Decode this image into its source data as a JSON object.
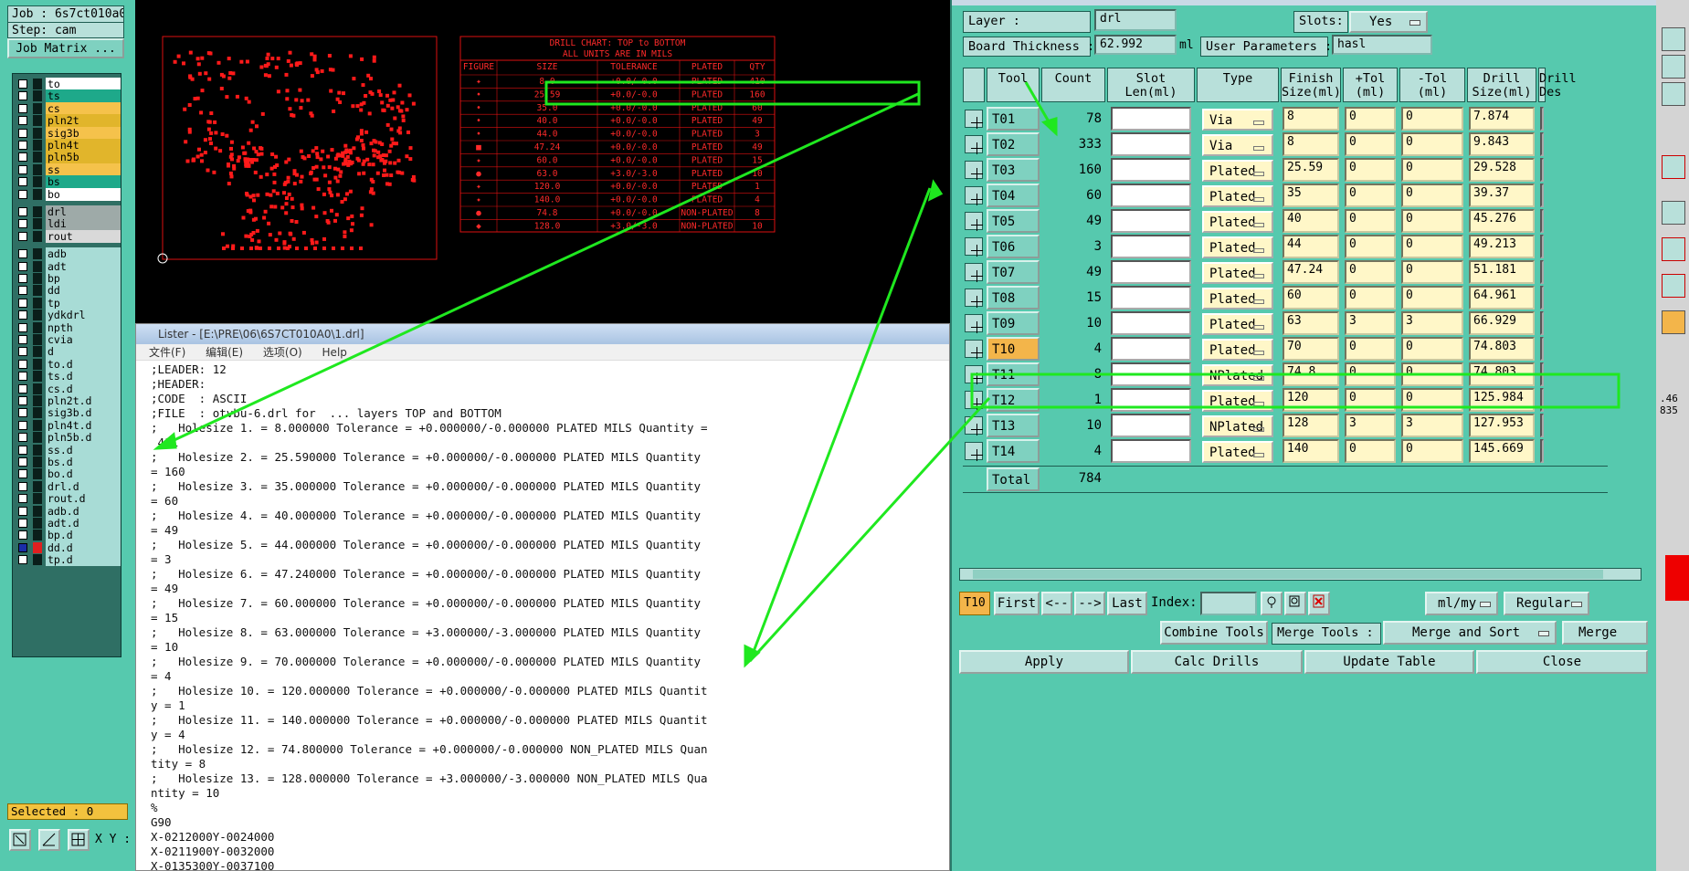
{
  "job": {
    "job_line": "Job : 6s7ct010a0",
    "step_line": "Step: cam",
    "job_matrix_label": "Job Matrix ...",
    "selected": "Selected : 0",
    "xy_label": "X Y :",
    "right_edge": ".46\n835"
  },
  "colors": {
    "panel": "#56c9ae",
    "accent_green": "#1fe81f",
    "selected_tool": "#f3b54a",
    "pcb_red": "#ff1a1a"
  },
  "layers": [
    {
      "name": "to",
      "color": "#ffffff",
      "swatch": "#0a1e1a"
    },
    {
      "name": "ts",
      "color": "#1ea98a",
      "swatch": "#0a1e1a"
    },
    {
      "name": "cs",
      "color": "#f5c24b",
      "swatch": "#0a1e1a"
    },
    {
      "name": "pln2t",
      "color": "#e1b52b",
      "swatch": "#0a1e1a"
    },
    {
      "name": "sig3b",
      "color": "#f5c24b",
      "swatch": "#0a1e1a"
    },
    {
      "name": "pln4t",
      "color": "#e1b52b",
      "swatch": "#0a1e1a"
    },
    {
      "name": "pln5b",
      "color": "#e1b52b",
      "swatch": "#0a1e1a"
    },
    {
      "name": "ss",
      "color": "#f5c24b",
      "swatch": "#0a1e1a"
    },
    {
      "name": "bs",
      "color": "#1ea98a",
      "swatch": "#0a1e1a"
    },
    {
      "name": "bo",
      "color": "#ffffff",
      "swatch": "#0a1e1a"
    },
    {
      "name": "drl",
      "color": "#9eaaa8",
      "swatch": "#0a1e1a"
    },
    {
      "name": "ldi",
      "color": "#9eaaa8",
      "swatch": "#0a1e1a"
    },
    {
      "name": "rout",
      "color": "#d9d9d9",
      "swatch": "#0a1e1a"
    },
    {
      "name": "adb",
      "color": "#a8dcd6",
      "swatch": "#0a1e1a"
    },
    {
      "name": "adt",
      "color": "#a8dcd6",
      "swatch": "#0a1e1a"
    },
    {
      "name": "bp",
      "color": "#a8dcd6",
      "swatch": "#0a1e1a"
    },
    {
      "name": "dd",
      "color": "#a8dcd6",
      "swatch": "#0a1e1a"
    },
    {
      "name": "tp",
      "color": "#a8dcd6",
      "swatch": "#0a1e1a"
    },
    {
      "name": "ydkdrl",
      "color": "#a8dcd6",
      "swatch": "#0a1e1a"
    },
    {
      "name": "npth",
      "color": "#a8dcd6",
      "swatch": "#0a1e1a"
    },
    {
      "name": "cvia",
      "color": "#a8dcd6",
      "swatch": "#0a1e1a"
    },
    {
      "name": "d",
      "color": "#a8dcd6",
      "swatch": "#0a1e1a"
    },
    {
      "name": "to.d",
      "color": "#a8dcd6",
      "swatch": "#0a1e1a",
      "mark": "◆"
    },
    {
      "name": "ts.d",
      "color": "#a8dcd6",
      "swatch": "#0a1e1a"
    },
    {
      "name": "cs.d",
      "color": "#a8dcd6",
      "swatch": "#0a1e1a"
    },
    {
      "name": "pln2t.d",
      "color": "#a8dcd6",
      "swatch": "#0a1e1a"
    },
    {
      "name": "sig3b.d",
      "color": "#a8dcd6",
      "swatch": "#0a1e1a"
    },
    {
      "name": "pln4t.d",
      "color": "#a8dcd6",
      "swatch": "#0a1e1a"
    },
    {
      "name": "pln5b.d",
      "color": "#a8dcd6",
      "swatch": "#0a1e1a"
    },
    {
      "name": "ss.d",
      "color": "#a8dcd6",
      "swatch": "#0a1e1a"
    },
    {
      "name": "bs.d",
      "color": "#a8dcd6",
      "swatch": "#0a1e1a"
    },
    {
      "name": "bo.d",
      "color": "#a8dcd6",
      "swatch": "#0a1e1a"
    },
    {
      "name": "drl.d",
      "color": "#a8dcd6",
      "swatch": "#0a1e1a"
    },
    {
      "name": "rout.d",
      "color": "#a8dcd6",
      "swatch": "#0a1e1a"
    },
    {
      "name": "adb.d",
      "color": "#a8dcd6",
      "swatch": "#0a1e1a"
    },
    {
      "name": "adt.d",
      "color": "#a8dcd6",
      "swatch": "#0a1e1a",
      "mark": "◆"
    },
    {
      "name": "bp.d",
      "color": "#a8dcd6",
      "swatch": "#0a1e1a"
    },
    {
      "name": "dd.d",
      "color": "#a8dcd6",
      "swatch": "#e02020",
      "checked": true,
      "mark": "▪"
    },
    {
      "name": "tp.d",
      "color": "#a8dcd6",
      "swatch": "#0a1e1a"
    }
  ],
  "drill_chart": {
    "title": "DRILL CHART: TOP to BOTTOM",
    "subtitle": "ALL UNITS ARE IN MILS",
    "headers": [
      "FIGURE",
      "SIZE",
      "TOLERANCE",
      "PLATED",
      "QTY"
    ],
    "rows": [
      [
        "✦",
        "8.0",
        "+0.0/-0.0",
        "PLATED",
        "410"
      ],
      [
        "•",
        "25.59",
        "+0.0/-0.0",
        "PLATED",
        "160"
      ],
      [
        "•",
        "35.0",
        "+0.0/-0.0",
        "PLATED",
        "60"
      ],
      [
        "•",
        "40.0",
        "+0.0/-0.0",
        "PLATED",
        "49"
      ],
      [
        "•",
        "44.0",
        "+0.0/-0.0",
        "PLATED",
        "3"
      ],
      [
        "■",
        "47.24",
        "+0.0/-0.0",
        "PLATED",
        "49"
      ],
      [
        "✦",
        "60.0",
        "+0.0/-0.0",
        "PLATED",
        "15"
      ],
      [
        "●",
        "63.0",
        "+3.0/-3.0",
        "PLATED",
        "10"
      ],
      [
        "✦",
        "120.0",
        "+0.0/-0.0",
        "PLATED",
        "1"
      ],
      [
        "✦",
        "140.0",
        "+0.0/-0.0",
        "PLATED",
        "4"
      ],
      [
        "●",
        "74.8",
        "+0.0/-0.0",
        "NON-PLATED",
        "8"
      ],
      [
        "◆",
        "128.0",
        "+3.0/-3.0",
        "NON-PLATED",
        "10"
      ]
    ]
  },
  "lister": {
    "title": "Lister - [E:\\PRE\\06\\6S7CT010A0\\1.drl]",
    "menus": [
      "文件(F)",
      "编辑(E)",
      "选项(O)",
      "Help"
    ],
    "lines": [
      ";LEADER: 12",
      ";HEADER:",
      ";CODE  : ASCII",
      ";FILE  : otvbu-6.drl for  ... layers TOP and BOTTOM",
      ";   Holesize 1. = 8.000000 Tolerance = +0.000000/-0.000000 PLATED MILS Quantity =",
      " 411",
      ";   Holesize 2. = 25.590000 Tolerance = +0.000000/-0.000000 PLATED MILS Quantity",
      "= 160",
      ";   Holesize 3. = 35.000000 Tolerance = +0.000000/-0.000000 PLATED MILS Quantity",
      "= 60",
      ";   Holesize 4. = 40.000000 Tolerance = +0.000000/-0.000000 PLATED MILS Quantity",
      "= 49",
      ";   Holesize 5. = 44.000000 Tolerance = +0.000000/-0.000000 PLATED MILS Quantity",
      "= 3",
      ";   Holesize 6. = 47.240000 Tolerance = +0.000000/-0.000000 PLATED MILS Quantity",
      "= 49",
      ";   Holesize 7. = 60.000000 Tolerance = +0.000000/-0.000000 PLATED MILS Quantity",
      "= 15",
      ";   Holesize 8. = 63.000000 Tolerance = +3.000000/-3.000000 PLATED MILS Quantity",
      "= 10",
      ";   Holesize 9. = 70.000000 Tolerance = +0.000000/-0.000000 PLATED MILS Quantity",
      "= 4",
      ";   Holesize 10. = 120.000000 Tolerance = +0.000000/-0.000000 PLATED MILS Quantit",
      "y = 1",
      ";   Holesize 11. = 140.000000 Tolerance = +0.000000/-0.000000 PLATED MILS Quantit",
      "y = 4",
      ";   Holesize 12. = 74.800000 Tolerance = +0.000000/-0.000000 NON_PLATED MILS Quan",
      "tity = 8",
      ";   Holesize 13. = 128.000000 Tolerance = +3.000000/-3.000000 NON_PLATED MILS Qua",
      "ntity = 10",
      "%",
      "G90",
      "X-0212000Y-0024000",
      "X-0211900Y-0032000",
      "X-0135300Y-0037100"
    ]
  },
  "panel": {
    "layer_label": "Layer          :",
    "layer_value": "drl",
    "slots_label": "Slots:",
    "slots_value": "Yes",
    "thickness_label": "Board Thickness :",
    "thickness_value": "62.992",
    "thickness_unit": "ml",
    "user_params_label": "User Parameters :",
    "user_params_value": "hasl",
    "headers": [
      "Tool",
      "Count",
      "Slot\nLen(ml)",
      "Type",
      "Finish\nSize(ml)",
      "+Tol\n(ml)",
      "-Tol\n(ml)",
      "Drill\nSize(ml)",
      "Drill\nDes"
    ],
    "tools": [
      {
        "tool": "T01",
        "count": "78",
        "type": "Via",
        "finish": "8",
        "ptol": "0",
        "ntol": "0",
        "drill": "7.874"
      },
      {
        "tool": "T02",
        "count": "333",
        "type": "Via",
        "finish": "8",
        "ptol": "0",
        "ntol": "0",
        "drill": "9.843"
      },
      {
        "tool": "T03",
        "count": "160",
        "type": "Plated",
        "finish": "25.59",
        "ptol": "0",
        "ntol": "0",
        "drill": "29.528"
      },
      {
        "tool": "T04",
        "count": "60",
        "type": "Plated",
        "finish": "35",
        "ptol": "0",
        "ntol": "0",
        "drill": "39.37"
      },
      {
        "tool": "T05",
        "count": "49",
        "type": "Plated",
        "finish": "40",
        "ptol": "0",
        "ntol": "0",
        "drill": "45.276"
      },
      {
        "tool": "T06",
        "count": "3",
        "type": "Plated",
        "finish": "44",
        "ptol": "0",
        "ntol": "0",
        "drill": "49.213"
      },
      {
        "tool": "T07",
        "count": "49",
        "type": "Plated",
        "finish": "47.24",
        "ptol": "0",
        "ntol": "0",
        "drill": "51.181"
      },
      {
        "tool": "T08",
        "count": "15",
        "type": "Plated",
        "finish": "60",
        "ptol": "0",
        "ntol": "0",
        "drill": "64.961"
      },
      {
        "tool": "T09",
        "count": "10",
        "type": "Plated",
        "finish": "63",
        "ptol": "3",
        "ntol": "3",
        "drill": "66.929"
      },
      {
        "tool": "T10",
        "count": "4",
        "type": "Plated",
        "finish": "70",
        "ptol": "0",
        "ntol": "0",
        "drill": "74.803",
        "selected": true
      },
      {
        "tool": "T11",
        "count": "8",
        "type": "NPlated",
        "finish": "74.8",
        "ptol": "0",
        "ntol": "0",
        "drill": "74.803"
      },
      {
        "tool": "T12",
        "count": "1",
        "type": "Plated",
        "finish": "120",
        "ptol": "0",
        "ntol": "0",
        "drill": "125.984"
      },
      {
        "tool": "T13",
        "count": "10",
        "type": "NPlated",
        "finish": "128",
        "ptol": "3",
        "ntol": "3",
        "drill": "127.953"
      },
      {
        "tool": "T14",
        "count": "4",
        "type": "Plated",
        "finish": "140",
        "ptol": "0",
        "ntol": "0",
        "drill": "145.669"
      }
    ],
    "total_label": "Total",
    "total_value": "784",
    "current_tool": "T10",
    "nav": {
      "first": "First",
      "prev": "<--",
      "next": "-->",
      "last": "Last",
      "index": "Index:"
    },
    "units": "ml/my",
    "mode": "Regular",
    "combine": "Combine Tools",
    "merge_tools": "Merge Tools :",
    "merge_sort": "Merge and Sort",
    "merge": "Merge",
    "apply": "Apply",
    "calc": "Calc Drills",
    "update": "Update Table",
    "close": "Close"
  }
}
